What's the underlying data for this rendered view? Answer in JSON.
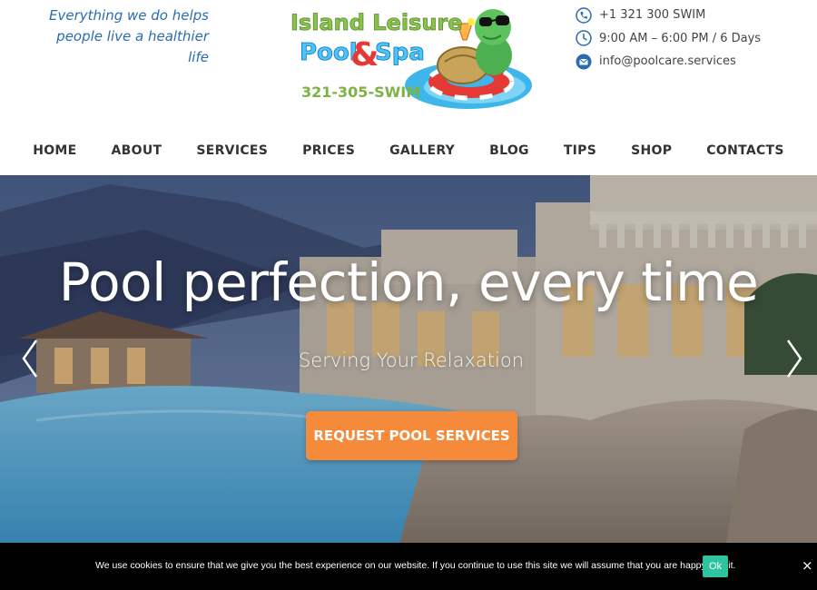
{
  "header": {
    "tagline_line1": "Everything we do helps",
    "tagline_line2": "people live a healthier life",
    "logo": {
      "line1": "Island Leisure",
      "line2_a": "Pool",
      "line2_amp": "&",
      "line2_b": "Spa",
      "phone": "321-305-SWIM"
    },
    "contacts": {
      "phone": "+1 321 300 SWIM",
      "hours": "9:00 AM – 6:00 PM / 6 Days",
      "email": "info@poolcare.services"
    }
  },
  "nav": {
    "items": [
      "HOME",
      "ABOUT",
      "SERVICES",
      "PRICES",
      "GALLERY",
      "BLOG",
      "TIPS",
      "SHOP",
      "CONTACTS"
    ]
  },
  "hero": {
    "title": "Pool perfection, every time",
    "subtitle": "Serving Your Relaxation",
    "button_label": "REQUEST POOL SERVICES",
    "prev_icon": "chevron-left-icon",
    "next_icon": "chevron-right-icon"
  },
  "cookie_bar": {
    "text": "We use cookies to ensure that we give you the best experience on our website. If you continue to use this site we will assume that you are happy with it.",
    "ok_label": "Ok",
    "close_label": "×"
  },
  "colors": {
    "accent_blue": "#2b6cb0",
    "button_orange": "#f58b3a",
    "ok_green": "#2ec4a0",
    "nav_text": "#333333"
  }
}
